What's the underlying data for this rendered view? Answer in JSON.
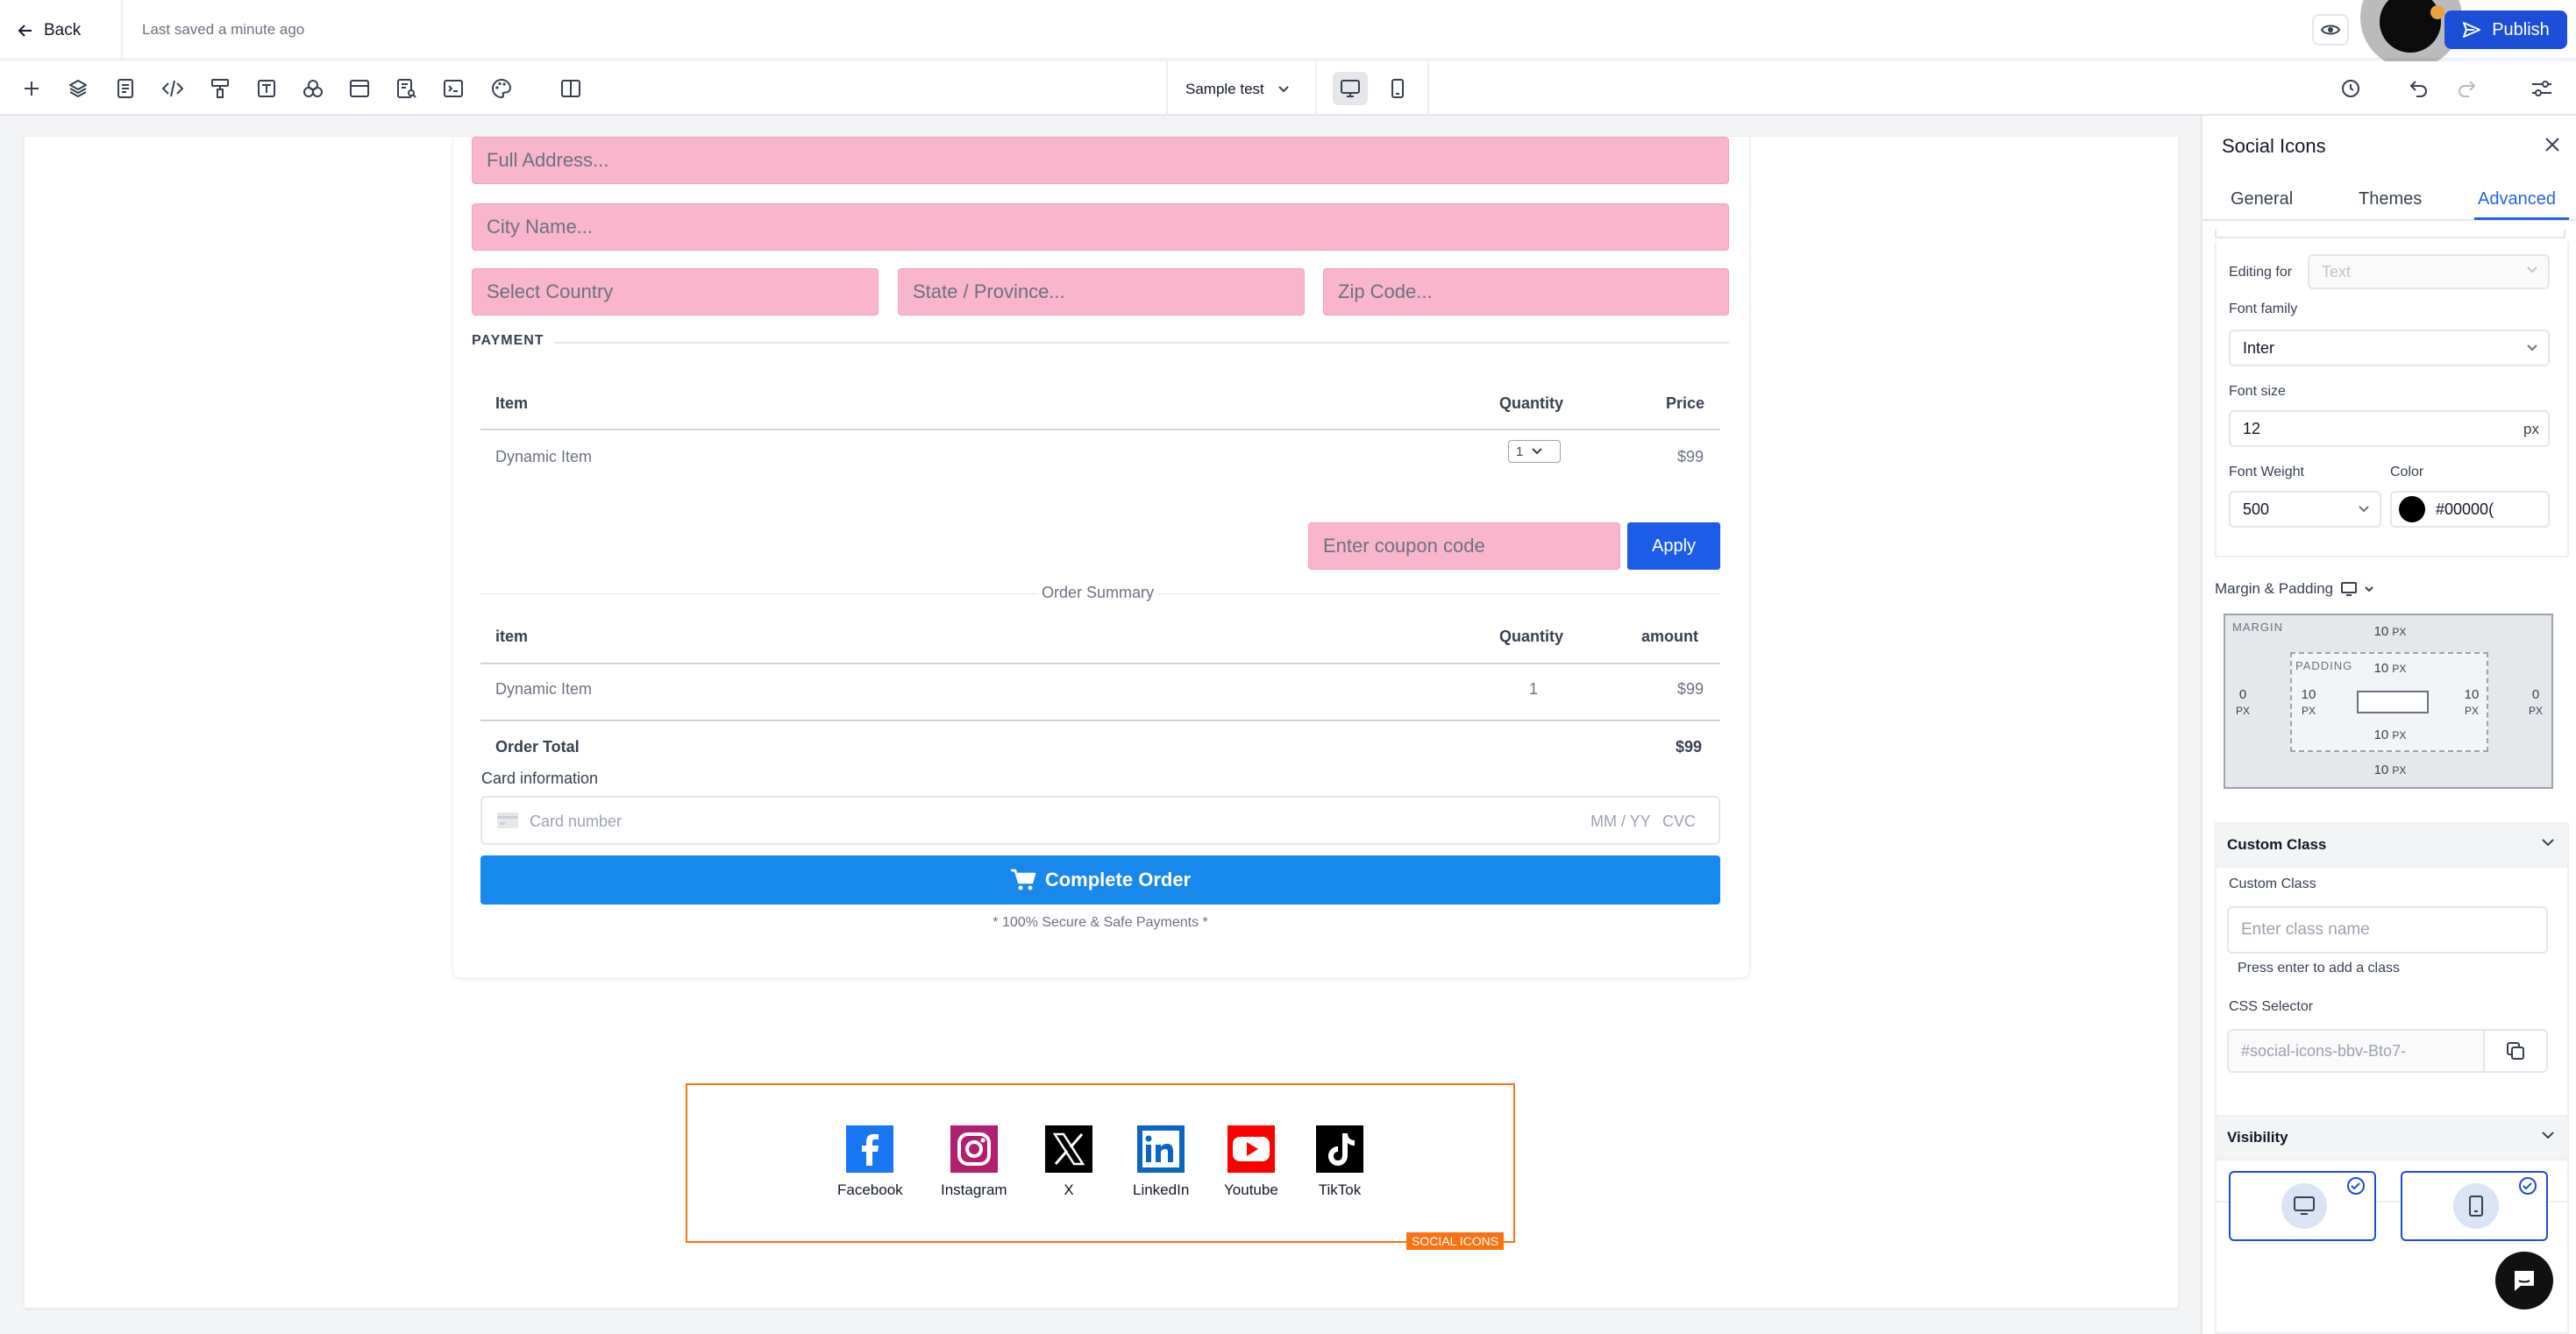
{
  "topbar": {
    "back_label": "Back",
    "saved_status": "Last saved a minute ago",
    "publish_label": "Publish"
  },
  "toolbar": {
    "icons": [
      "plus-icon",
      "layers-icon",
      "page-icon",
      "code-icon",
      "paint-roller-icon",
      "text-icon",
      "shapes-icon",
      "browser-window-icon",
      "form-search-icon",
      "terminal-icon",
      "palette-icon",
      "split-view-icon"
    ],
    "page_selector": "Sample test",
    "right_icons": [
      "history-icon",
      "undo-icon",
      "redo-icon",
      "settings-sliders-icon"
    ]
  },
  "form": {
    "address_placeholder": "Full Address...",
    "city_placeholder": "City Name...",
    "country_placeholder": "Select Country",
    "state_placeholder": "State / Province...",
    "zip_placeholder": "Zip Code...",
    "payment_label": "PAYMENT",
    "items_table": {
      "headers": [
        "Item",
        "Quantity",
        "Price"
      ],
      "rows": [
        {
          "item": "Dynamic Item",
          "quantity": "1",
          "price": "$99"
        }
      ]
    },
    "coupon_placeholder": "Enter coupon code",
    "apply_label": "Apply",
    "order_summary_label": "Order Summary",
    "summary_table": {
      "headers": [
        "item",
        "Quantity",
        "amount"
      ],
      "rows": [
        {
          "item": "Dynamic Item",
          "quantity": "1",
          "amount": "$99"
        }
      ],
      "total_label": "Order Total",
      "total_value": "$99"
    },
    "card_info_label": "Card information",
    "card_number_placeholder": "Card number",
    "card_exp_placeholder": "MM / YY",
    "card_cvc_placeholder": "CVC",
    "complete_label": "Complete Order",
    "secure_text": "* 100% Secure & Safe Payments *"
  },
  "social": {
    "tag": "SOCIAL ICONS",
    "items": [
      {
        "label": "Facebook",
        "color": "#1877f2"
      },
      {
        "label": "Instagram",
        "color": "#c13584"
      },
      {
        "label": "X",
        "color": "#000000"
      },
      {
        "label": "LinkedIn",
        "color": "#0a66c2"
      },
      {
        "label": "Youtube",
        "color": "#ff0000"
      },
      {
        "label": "TikTok",
        "color": "#000000"
      }
    ]
  },
  "panel": {
    "title": "Social Icons",
    "tabs": [
      "General",
      "Themes",
      "Advanced"
    ],
    "active_tab": "Advanced",
    "editing_for_label": "Editing for",
    "editing_for_value": "Text",
    "font_family_label": "Font family",
    "font_family_value": "Inter",
    "font_size_label": "Font size",
    "font_size_value": "12",
    "font_size_unit": "px",
    "font_weight_label": "Font Weight",
    "font_weight_value": "500",
    "color_label": "Color",
    "color_value": "#00000(",
    "margin_padding_label": "Margin & Padding",
    "box": {
      "margin_label": "MARGIN",
      "padding_label": "PADDING",
      "margin_top": "10",
      "margin_bottom": "10",
      "margin_left": "0",
      "margin_right": "0",
      "padding_top": "10",
      "padding_bottom": "10",
      "padding_left": "10",
      "padding_right": "10",
      "unit": "PX"
    },
    "custom_class_section": "Custom Class",
    "custom_class_label": "Custom Class",
    "custom_class_placeholder": "Enter class name",
    "custom_class_hint": "Press enter to add a class",
    "css_selector_label": "CSS Selector",
    "css_selector_value": "#social-icons-bbv-Bto7-",
    "visibility_section": "Visibility",
    "accent_color": "#1d4ed8"
  }
}
